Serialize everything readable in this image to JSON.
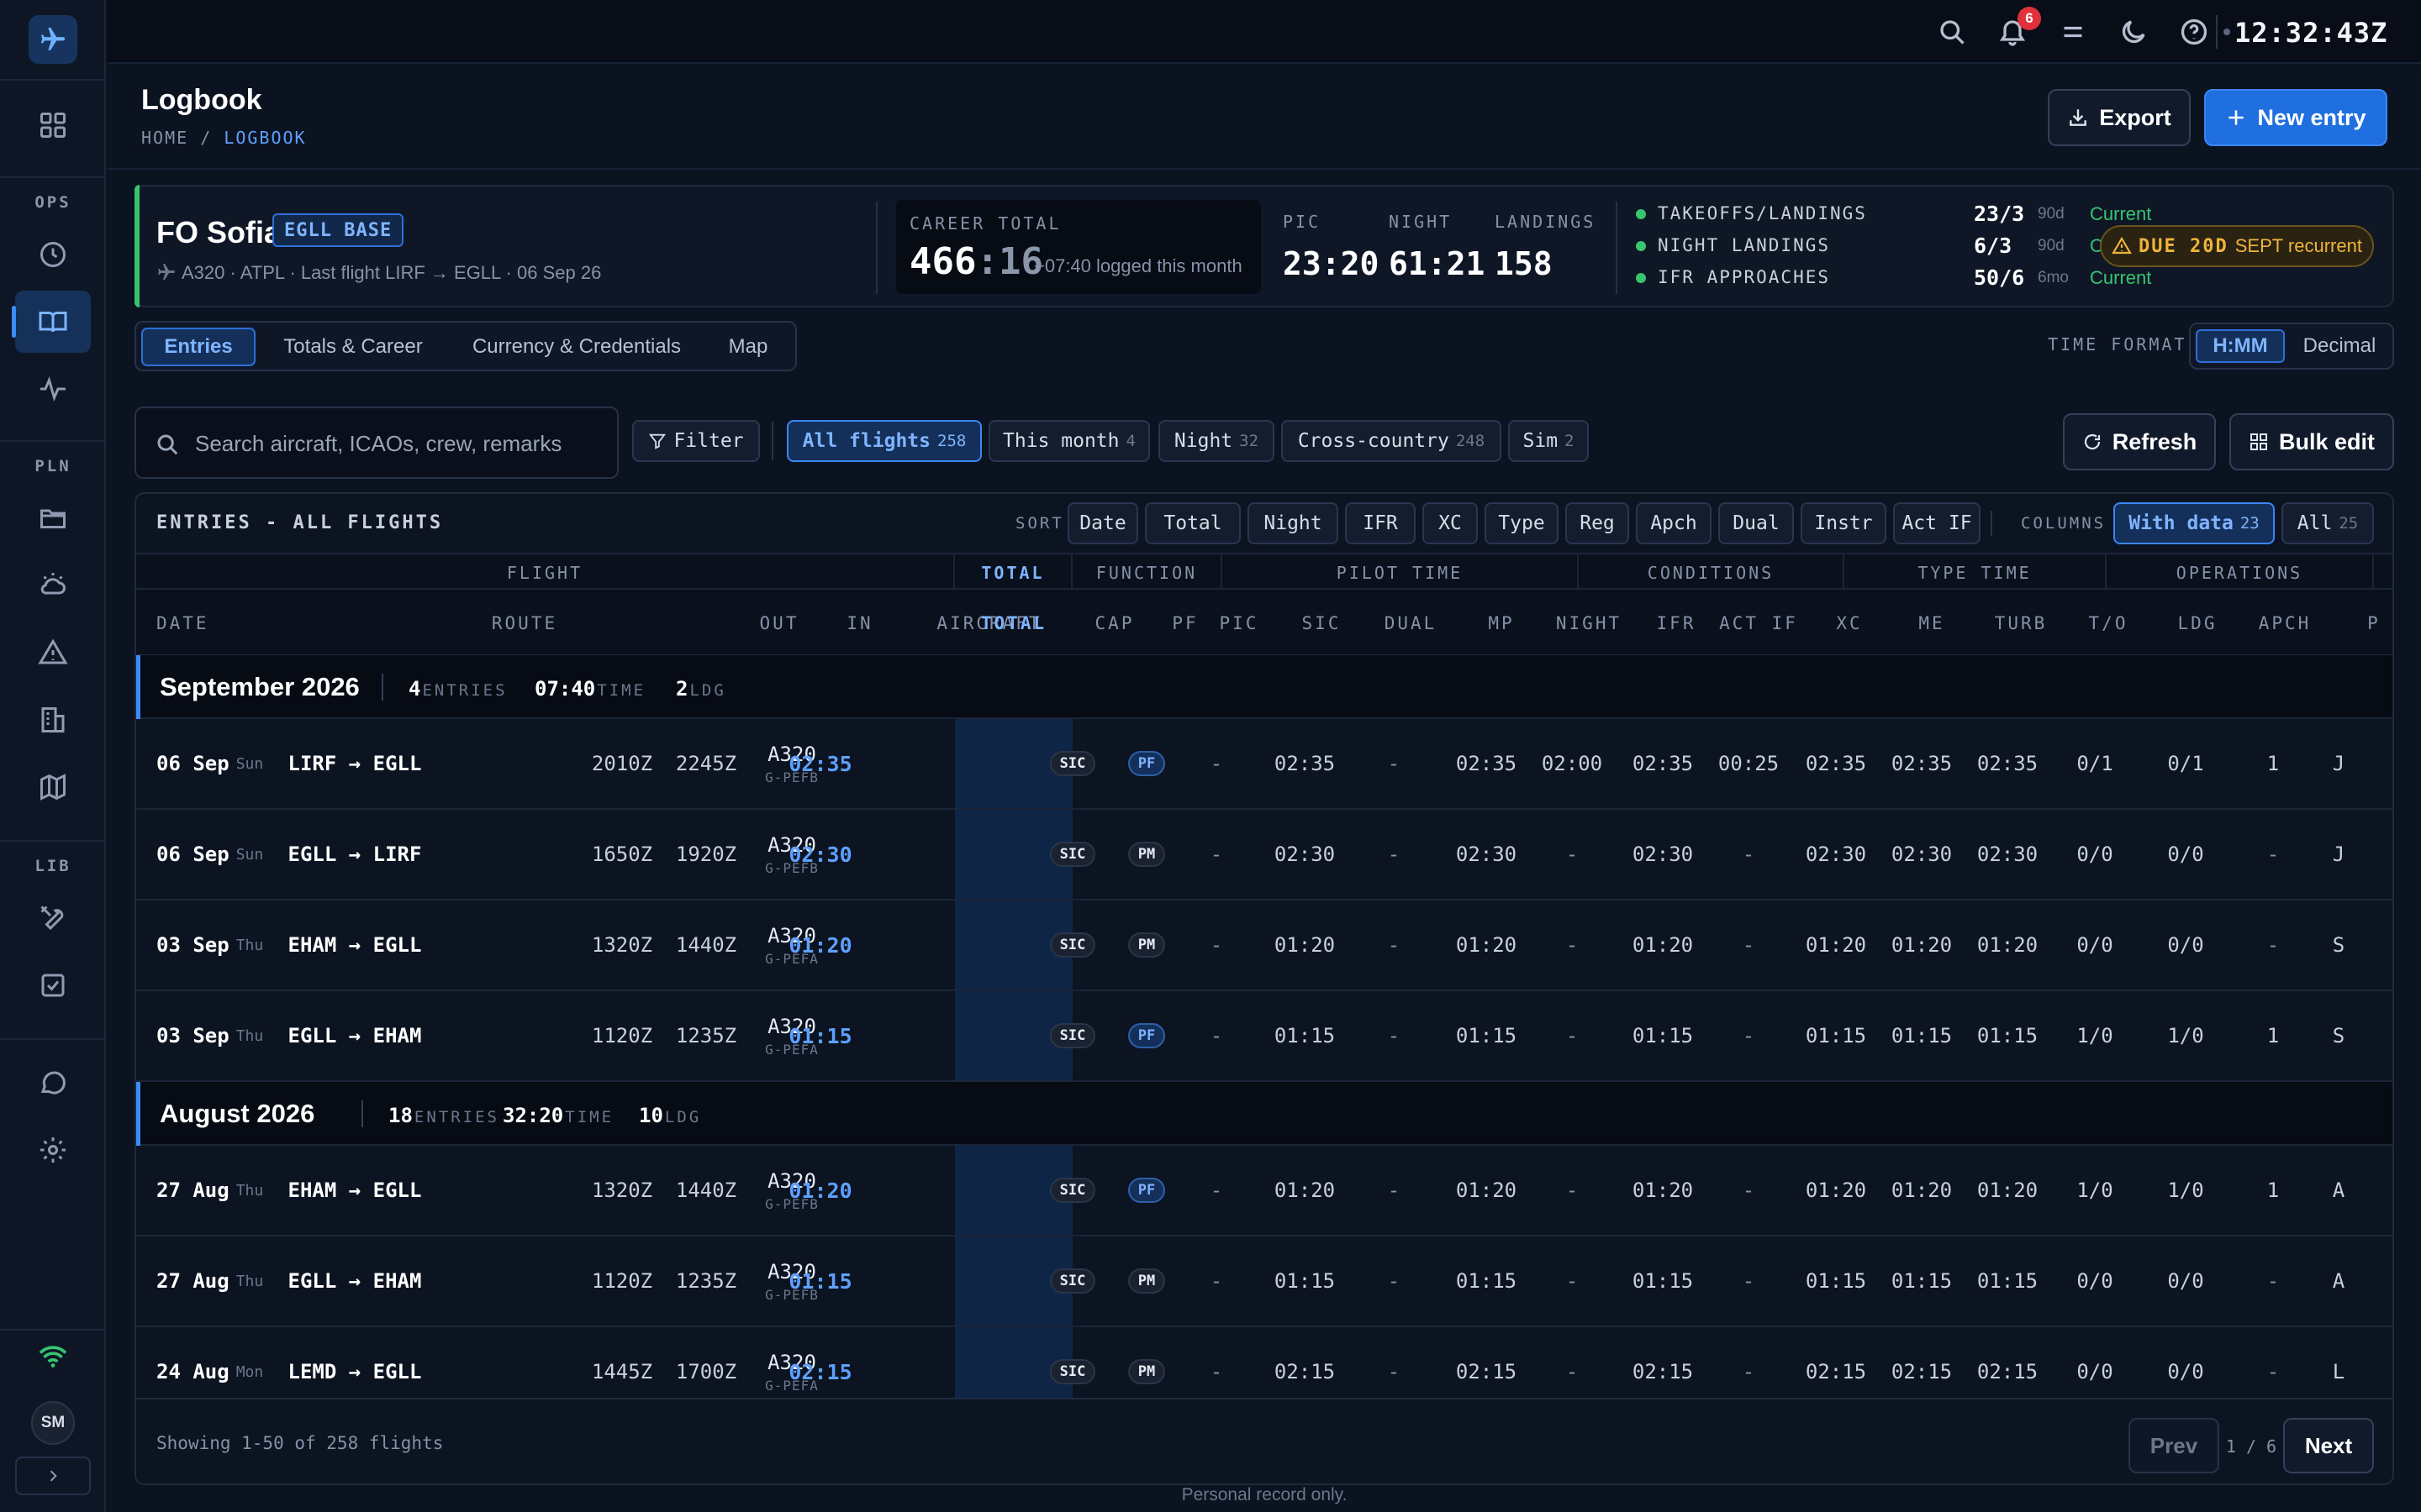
{
  "topbar": {
    "clock": "12:32:43Z",
    "notif_count": "6"
  },
  "sidebar": {
    "sections": [
      "OPS",
      "PLN",
      "LIB"
    ],
    "avatar": "SM"
  },
  "header": {
    "title": "Logbook",
    "crumb_home": "HOME",
    "crumb_sep": "/",
    "crumb_current": "LOGBOOK",
    "export_label": "Export",
    "new_label": "New entry"
  },
  "profile": {
    "name": "FO Sofia",
    "base": "EGLL BASE",
    "subtitle": "A320 · ATPL · Last flight LIRF → EGLL · 06 Sep 26",
    "career_label": "CAREER TOTAL",
    "career_hours": "466",
    "career_minutes": ":16",
    "career_sub": "+07:40 logged this month",
    "stats": [
      {
        "label": "PIC",
        "value": "23:20"
      },
      {
        "label": "NIGHT",
        "value": "61:21"
      },
      {
        "label": "LANDINGS",
        "value": "158"
      }
    ],
    "currency": [
      {
        "name": "TAKEOFFS/LANDINGS",
        "num": "23/3",
        "period": "90d",
        "status": "Current"
      },
      {
        "name": "NIGHT LANDINGS",
        "num": "6/3",
        "period": "90d",
        "status": "Current"
      },
      {
        "name": "IFR APPROACHES",
        "num": "50/6",
        "period": "6mo",
        "status": "Current"
      }
    ],
    "due_strong": "DUE 20D",
    "due_text": "SEPT recurrent"
  },
  "tabs": [
    "Entries",
    "Totals & Career",
    "Currency & Credentials",
    "Map"
  ],
  "time_format": {
    "label": "TIME FORMAT",
    "options": [
      "H:MM",
      "Decimal"
    ]
  },
  "search": {
    "placeholder": "Search aircraft, ICAOs, crew, remarks"
  },
  "filter_label": "Filter",
  "chips": [
    {
      "label": "All flights",
      "count": "258"
    },
    {
      "label": "This month",
      "count": "4"
    },
    {
      "label": "Night",
      "count": "32"
    },
    {
      "label": "Cross-country",
      "count": "248"
    },
    {
      "label": "Sim",
      "count": "2"
    }
  ],
  "refresh_label": "Refresh",
  "bulk_label": "Bulk edit",
  "table": {
    "title": "ENTRIES - ALL FLIGHTS",
    "sort_label": "SORT",
    "sort": [
      "Date",
      "Total",
      "Night",
      "IFR",
      "XC",
      "Type",
      "Reg",
      "Apch",
      "Dual",
      "Instr",
      "Act IF"
    ],
    "columns_label": "COLUMNS",
    "col_opts": [
      {
        "label": "With data",
        "count": "23"
      },
      {
        "label": "All",
        "count": "25"
      }
    ],
    "groups": [
      "FLIGHT",
      "TOTAL",
      "FUNCTION",
      "PILOT TIME",
      "CONDITIONS",
      "TYPE TIME",
      "OPERATIONS"
    ],
    "headers": [
      "DATE",
      "ROUTE",
      "OUT",
      "IN",
      "AIRCRAFT",
      "TOTAL",
      "CAP",
      "PF",
      "PIC",
      "SIC",
      "DUAL",
      "MP",
      "NIGHT",
      "IFR",
      "ACT IF",
      "XC",
      "ME",
      "TURB",
      "T/O",
      "LDG",
      "APCH",
      "P"
    ],
    "months": [
      {
        "name": "September 2026",
        "entries": "4",
        "entries_lbl": "ENTRIES",
        "time": "07:40",
        "time_lbl": "TIME",
        "ldg": "2",
        "ldg_lbl": "LDG"
      },
      {
        "name": "August 2026",
        "entries": "18",
        "entries_lbl": "ENTRIES",
        "time": "32:20",
        "time_lbl": "TIME",
        "ldg": "10",
        "ldg_lbl": "LDG"
      }
    ],
    "rows": [
      {
        "date": "06 Sep",
        "dow": "Sun",
        "route": "LIRF → EGLL",
        "out": "2010Z",
        "in": "2245Z",
        "type": "A320",
        "reg": "G-PEFB",
        "total": "02:35",
        "cap": "SIC",
        "pf": "PF",
        "pic": "-",
        "sic": "02:35",
        "dual": "-",
        "mp": "02:35",
        "night": "02:00",
        "ifr": "02:35",
        "actif": "00:25",
        "xc": "02:35",
        "me": "02:35",
        "turb": "02:35",
        "to": "0/1",
        "ldg": "0/1",
        "apch": "1",
        "p": "J"
      },
      {
        "date": "06 Sep",
        "dow": "Sun",
        "route": "EGLL → LIRF",
        "out": "1650Z",
        "in": "1920Z",
        "type": "A320",
        "reg": "G-PEFB",
        "total": "02:30",
        "cap": "SIC",
        "pf": "PM",
        "pic": "-",
        "sic": "02:30",
        "dual": "-",
        "mp": "02:30",
        "night": "-",
        "ifr": "02:30",
        "actif": "-",
        "xc": "02:30",
        "me": "02:30",
        "turb": "02:30",
        "to": "0/0",
        "ldg": "0/0",
        "apch": "-",
        "p": "J"
      },
      {
        "date": "03 Sep",
        "dow": "Thu",
        "route": "EHAM → EGLL",
        "out": "1320Z",
        "in": "1440Z",
        "type": "A320",
        "reg": "G-PEFA",
        "total": "01:20",
        "cap": "SIC",
        "pf": "PM",
        "pic": "-",
        "sic": "01:20",
        "dual": "-",
        "mp": "01:20",
        "night": "-",
        "ifr": "01:20",
        "actif": "-",
        "xc": "01:20",
        "me": "01:20",
        "turb": "01:20",
        "to": "0/0",
        "ldg": "0/0",
        "apch": "-",
        "p": "S"
      },
      {
        "date": "03 Sep",
        "dow": "Thu",
        "route": "EGLL → EHAM",
        "out": "1120Z",
        "in": "1235Z",
        "type": "A320",
        "reg": "G-PEFA",
        "total": "01:15",
        "cap": "SIC",
        "pf": "PF",
        "pic": "-",
        "sic": "01:15",
        "dual": "-",
        "mp": "01:15",
        "night": "-",
        "ifr": "01:15",
        "actif": "-",
        "xc": "01:15",
        "me": "01:15",
        "turb": "01:15",
        "to": "1/0",
        "ldg": "1/0",
        "apch": "1",
        "p": "S"
      },
      {
        "date": "27 Aug",
        "dow": "Thu",
        "route": "EHAM → EGLL",
        "out": "1320Z",
        "in": "1440Z",
        "type": "A320",
        "reg": "G-PEFB",
        "total": "01:20",
        "cap": "SIC",
        "pf": "PF",
        "pic": "-",
        "sic": "01:20",
        "dual": "-",
        "mp": "01:20",
        "night": "-",
        "ifr": "01:20",
        "actif": "-",
        "xc": "01:20",
        "me": "01:20",
        "turb": "01:20",
        "to": "1/0",
        "ldg": "1/0",
        "apch": "1",
        "p": "A"
      },
      {
        "date": "27 Aug",
        "dow": "Thu",
        "route": "EGLL → EHAM",
        "out": "1120Z",
        "in": "1235Z",
        "type": "A320",
        "reg": "G-PEFB",
        "total": "01:15",
        "cap": "SIC",
        "pf": "PM",
        "pic": "-",
        "sic": "01:15",
        "dual": "-",
        "mp": "01:15",
        "night": "-",
        "ifr": "01:15",
        "actif": "-",
        "xc": "01:15",
        "me": "01:15",
        "turb": "01:15",
        "to": "0/0",
        "ldg": "0/0",
        "apch": "-",
        "p": "A"
      },
      {
        "date": "24 Aug",
        "dow": "Mon",
        "route": "LEMD → EGLL",
        "out": "1445Z",
        "in": "1700Z",
        "type": "A320",
        "reg": "G-PEFA",
        "total": "02:15",
        "cap": "SIC",
        "pf": "PM",
        "pic": "-",
        "sic": "02:15",
        "dual": "-",
        "mp": "02:15",
        "night": "-",
        "ifr": "02:15",
        "actif": "-",
        "xc": "02:15",
        "me": "02:15",
        "turb": "02:15",
        "to": "0/0",
        "ldg": "0/0",
        "apch": "-",
        "p": "L"
      }
    ],
    "footer_info": "Showing 1-50 of 258 flights",
    "prev": "Prev",
    "page": "1 / 6",
    "next": "Next"
  },
  "note": "Personal record only."
}
